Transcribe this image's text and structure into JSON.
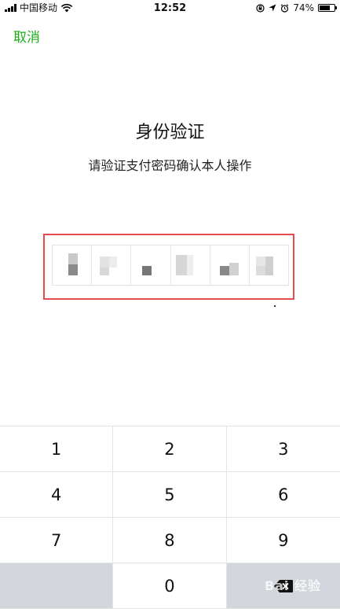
{
  "status_bar": {
    "carrier": "中国移动",
    "time": "12:52",
    "battery_percent": "74%",
    "battery_level": 0.74,
    "icons": [
      "signal-icon",
      "wifi-icon",
      "lock-rotation-icon",
      "location-icon",
      "alarm-icon",
      "battery-icon"
    ]
  },
  "header": {
    "cancel_label": "取消",
    "title": "身份验证",
    "subtitle": "请验证支付密码确认本人操作"
  },
  "password_input": {
    "digit_count": 6,
    "masked": true
  },
  "keypad": {
    "keys": [
      "1",
      "2",
      "3",
      "4",
      "5",
      "6",
      "7",
      "8",
      "9",
      "",
      "0",
      "⌫"
    ],
    "backspace_icon": "backspace-icon"
  },
  "watermark": "Bai 经验",
  "colors": {
    "accent": "#1aad19",
    "highlight": "#e34c4c",
    "keypad_gray": "#d2d5db"
  }
}
